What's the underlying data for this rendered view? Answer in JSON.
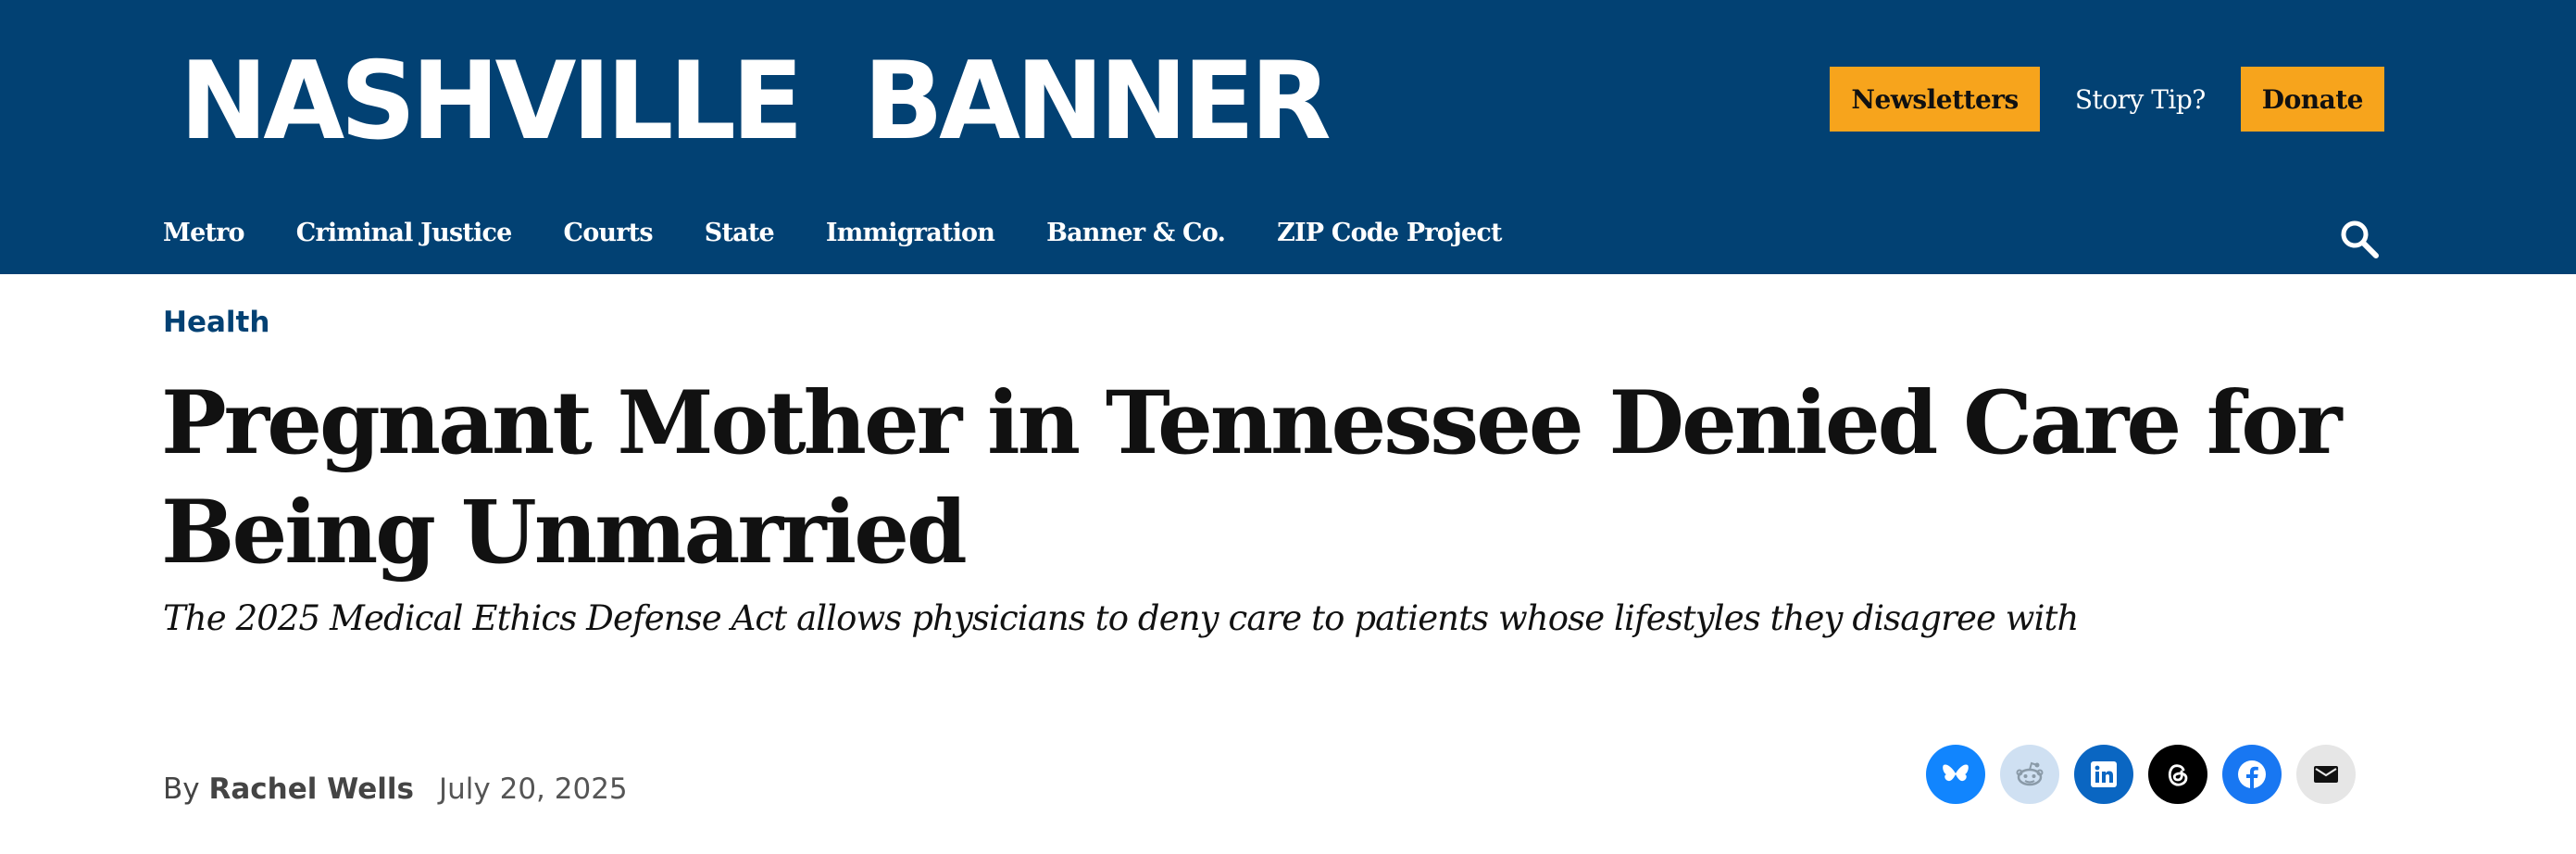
{
  "site": {
    "logo_text": "NASHVILLE  BANNER",
    "colors": {
      "header_bg": "#024173",
      "accent": "#f7a41c"
    }
  },
  "header": {
    "newsletters_label": "Newsletters",
    "story_tip_label": "Story Tip?",
    "donate_label": "Donate"
  },
  "nav": {
    "items": [
      {
        "label": "Metro"
      },
      {
        "label": "Criminal Justice"
      },
      {
        "label": "Courts"
      },
      {
        "label": "State"
      },
      {
        "label": "Immigration"
      },
      {
        "label": "Banner & Co."
      },
      {
        "label": "ZIP Code Project"
      }
    ],
    "search_icon": "search-icon"
  },
  "article": {
    "category": "Health",
    "headline": "Pregnant Mother in Tennessee Denied Care for Being Unmarried",
    "dek": "The 2025 Medical Ethics Defense Act allows physicians to deny care to patients whose lifestyles they disagree with",
    "byline_prefix": "By",
    "author": "Rachel Wells",
    "date": "July 20, 2025"
  },
  "share": [
    {
      "name": "bluesky",
      "icon": "butterfly-icon",
      "color": "#1185fe"
    },
    {
      "name": "reddit",
      "icon": "reddit-icon",
      "color": "#cfe0f2"
    },
    {
      "name": "linkedin",
      "icon": "linkedin-icon",
      "color": "#0a66c2"
    },
    {
      "name": "threads",
      "icon": "threads-icon",
      "color": "#000000"
    },
    {
      "name": "facebook",
      "icon": "facebook-icon",
      "color": "#1877f2"
    },
    {
      "name": "email",
      "icon": "envelope-icon",
      "color": "#e6e6e6"
    }
  ]
}
